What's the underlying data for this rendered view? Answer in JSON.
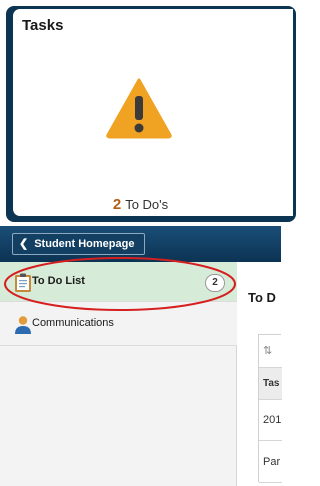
{
  "tile": {
    "title": "Tasks",
    "count": "2",
    "count_label": "To Do's",
    "icon": "warning-triangle-icon"
  },
  "navbar": {
    "back_label": "Student Homepage"
  },
  "sidebar": {
    "items": [
      {
        "label": "To Do List",
        "badge": "2",
        "icon": "clipboard-icon",
        "active": true
      },
      {
        "label": "Communications",
        "icon": "person-icon",
        "active": false
      }
    ]
  },
  "content": {
    "title": "To D",
    "sort_icon": "⇅",
    "table": {
      "header": "Tas",
      "rows": [
        "201",
        "Par"
      ]
    }
  },
  "colors": {
    "navbar": "#0f3a5d",
    "tile_frame": "#0b3553",
    "warning": "#f0a323",
    "active_item": "#d6ecd9",
    "annotation": "#d62020",
    "count": "#b35f15"
  }
}
